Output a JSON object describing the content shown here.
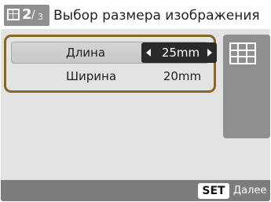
{
  "header": {
    "page_current": "2",
    "page_separator": "/",
    "page_total": "3",
    "title": "Выбор размера изображения",
    "badge_icon": "grid-icon"
  },
  "settings": {
    "rows": [
      {
        "label": "Длина",
        "value": "25mm",
        "selected": true
      },
      {
        "label": "Ширина",
        "value": "20mm",
        "selected": false
      }
    ]
  },
  "preview": {
    "icon": "grid-layout-icon"
  },
  "footer": {
    "set_key": "SET",
    "next_label": "Далее"
  },
  "colors": {
    "accent_border": "#8a6420",
    "header_badge": "#8f8f8f",
    "value_box": "#2a2a2a",
    "footer_bar": "#7c7c7c"
  }
}
